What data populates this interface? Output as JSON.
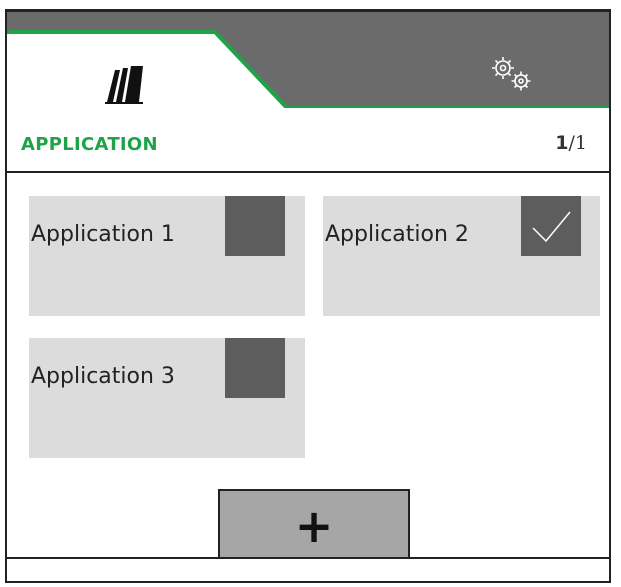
{
  "tabs": [
    {
      "icon": "application-field-icon",
      "active": true
    },
    {
      "icon": "settings-gears-icon",
      "active": false
    }
  ],
  "header": {
    "title": "APPLICATION",
    "page_current": "1",
    "page_total": "/1"
  },
  "applications": [
    {
      "label": "Application 1",
      "checked": false
    },
    {
      "label": "Application 2",
      "checked": true
    },
    {
      "label": "Application 3",
      "checked": false
    }
  ],
  "add_button": {
    "label": "+"
  },
  "colors": {
    "accent": "#1fa34a",
    "tab_inactive": "#6b6b6b",
    "card": "#dcdcdc",
    "checkbox": "#5d5d5d"
  }
}
